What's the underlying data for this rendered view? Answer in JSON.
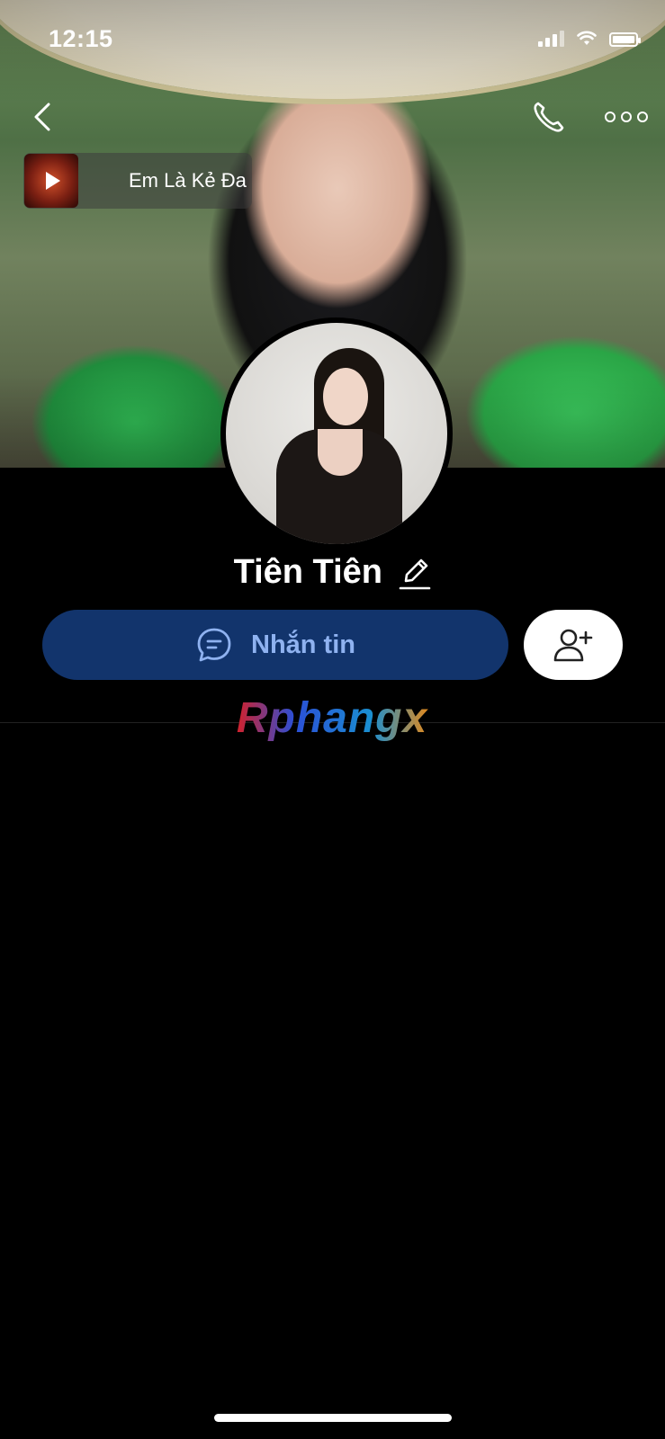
{
  "status_bar": {
    "time": "12:15"
  },
  "music": {
    "title": "Em Là Kẻ Đa"
  },
  "profile": {
    "name": "Tiên Tiên"
  },
  "actions": {
    "message_label": "Nhắn tin"
  },
  "watermark": {
    "text": "Rphangx"
  },
  "colors": {
    "message_button": "#12346c",
    "message_text": "#8fb2f0",
    "background": "#000000"
  },
  "icons": {
    "back": "chevron-left-icon",
    "call": "phone-icon",
    "more": "more-dots-icon",
    "edit": "pencil-icon",
    "message": "chat-bubble-icon",
    "add_friend": "add-user-icon"
  }
}
